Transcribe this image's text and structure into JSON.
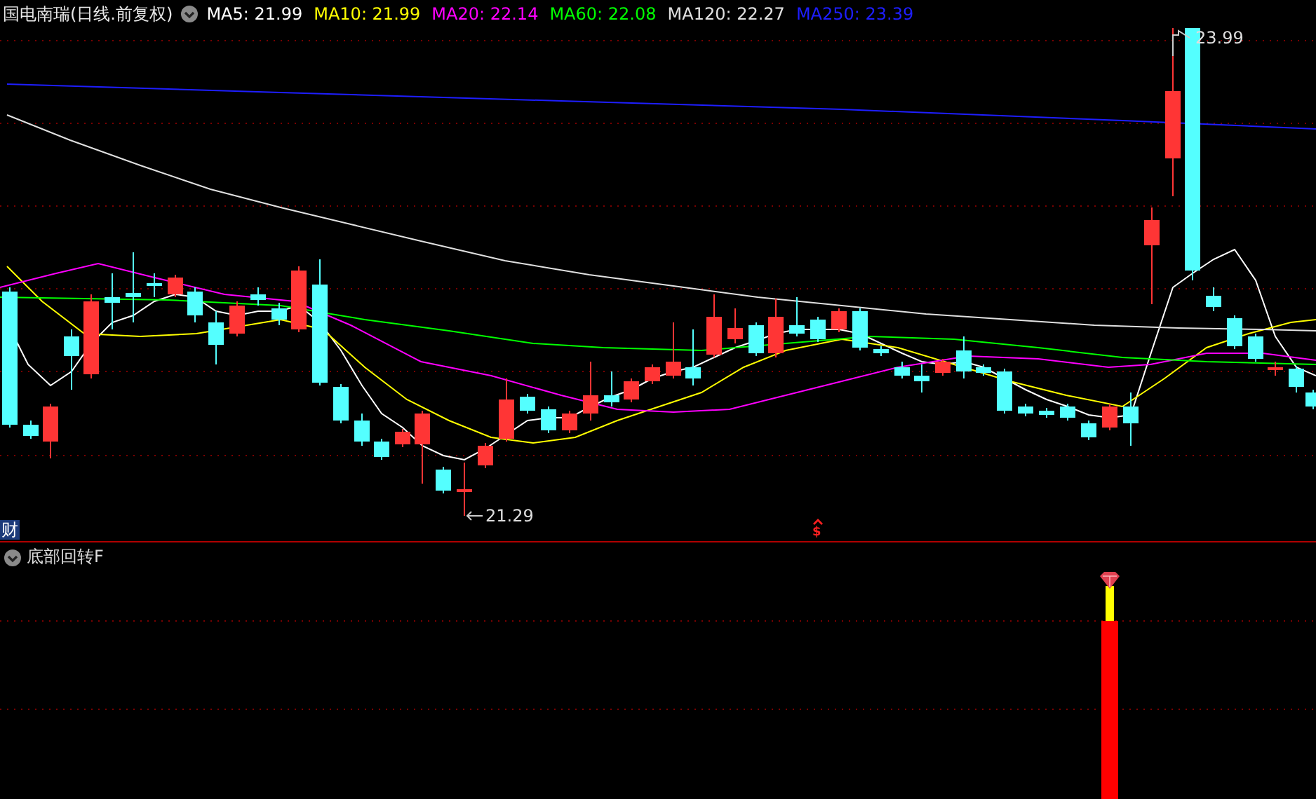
{
  "header": {
    "title": "国电南瑞(日线.前复权)",
    "legend": [
      {
        "label": "MA5: 21.99",
        "color": "#ffffff"
      },
      {
        "label": "MA10: 21.99",
        "color": "#ffff00"
      },
      {
        "label": "MA20: 22.14",
        "color": "#ff00ff"
      },
      {
        "label": "MA60: 22.08",
        "color": "#00ff00"
      },
      {
        "label": "MA120: 22.27",
        "color": "#e0e0e0"
      },
      {
        "label": "MA250: 23.39",
        "color": "#1e1eff"
      }
    ]
  },
  "price_chart": {
    "high_label": "23.99",
    "low_label": "21.29",
    "badge": "财",
    "marker": "$"
  },
  "indicator": {
    "title": "底部回转F"
  }
}
